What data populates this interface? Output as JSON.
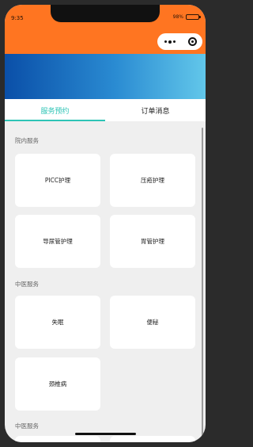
{
  "status": {
    "time": "9:35",
    "battery": "98%"
  },
  "tabs": [
    {
      "label": "服务预约",
      "active": true
    },
    {
      "label": "订单消息",
      "active": false
    }
  ],
  "sections": [
    {
      "title": "院内服务",
      "items": [
        "PICC护理",
        "压疮护理",
        "导尿管护理",
        "胃管护理"
      ]
    },
    {
      "title": "中医服务",
      "items": [
        "失眠",
        "便秘",
        "颈椎病"
      ]
    },
    {
      "title": "中医服务",
      "items": []
    }
  ],
  "colors": {
    "header": "#ff7521",
    "accent": "#2ec4b6",
    "banner_start": "#0a4fa8",
    "banner_end": "#62c7ea"
  },
  "icons": {
    "more": "more-dots-icon",
    "close": "close-circle-icon",
    "battery": "battery-icon"
  }
}
